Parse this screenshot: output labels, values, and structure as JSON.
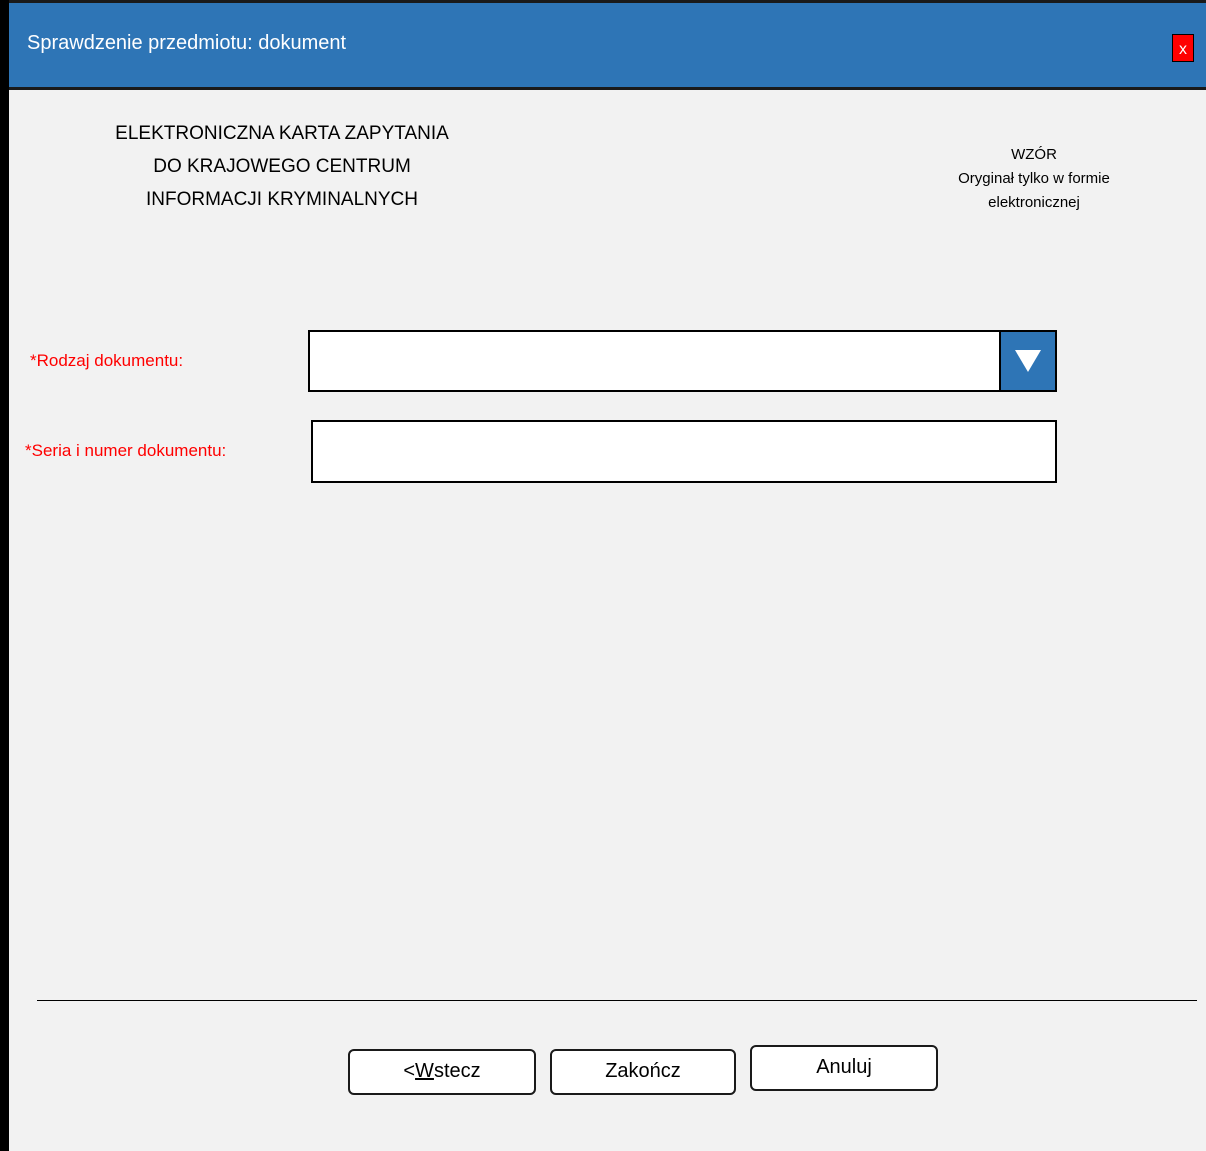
{
  "window": {
    "title": "Sprawdzenie przedmiotu: dokument",
    "close_label": "x",
    "accent_color": "#2e75b6",
    "close_color": "#ff0000"
  },
  "header": {
    "left_lines": [
      "ELEKTRONICZNA KARTA ZAPYTANIA",
      "DO KRAJOWEGO CENTRUM",
      "INFORMACJI KRYMINALNYCH"
    ],
    "right_lines": [
      "WZÓR",
      "Oryginał tylko w formie",
      "elektronicznej"
    ]
  },
  "form": {
    "document_type": {
      "label": "*Rodzaj dokumentu:",
      "value": "",
      "dropdown_icon": "triangle-down-icon"
    },
    "document_number": {
      "label": "*Seria i numer dokumentu:",
      "value": ""
    },
    "required_color": "#ff0000"
  },
  "buttons": {
    "back_prefix": "<",
    "back_mnemonic": "W",
    "back_rest": "stecz",
    "finish": "Zakończ",
    "cancel": "Anuluj"
  }
}
